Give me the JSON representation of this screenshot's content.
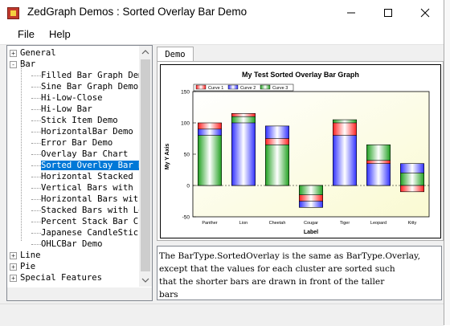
{
  "window": {
    "title": "ZedGraph Demos : Sorted Overlay Bar Demo"
  },
  "menu": {
    "file": "File",
    "help": "Help"
  },
  "tree": {
    "items": [
      {
        "label": "General",
        "expander": "+"
      },
      {
        "label": "Bar",
        "expander": "-"
      },
      {
        "label": "Filled Bar Graph Dem"
      },
      {
        "label": "Sine Bar Graph Demo"
      },
      {
        "label": "Hi-Low-Close"
      },
      {
        "label": "Hi-Low Bar"
      },
      {
        "label": "Stick Item Demo"
      },
      {
        "label": "HorizontalBar Demo"
      },
      {
        "label": "Error Bar Demo"
      },
      {
        "label": "Overlay Bar Chart"
      },
      {
        "label": "Sorted Overlay Bar D"
      },
      {
        "label": "Horizontal Stacked B"
      },
      {
        "label": "Vertical Bars with L"
      },
      {
        "label": "Horizontal Bars with"
      },
      {
        "label": "Stacked Bars with Le"
      },
      {
        "label": "Percent Stack Bar Ch"
      },
      {
        "label": "Japanese CandleStick"
      },
      {
        "label": "OHLCBar Demo"
      },
      {
        "label": "Line",
        "expander": "+"
      },
      {
        "label": "Pie",
        "expander": "+"
      },
      {
        "label": "Special Features",
        "expander": "+"
      }
    ]
  },
  "tabs": {
    "demo": "Demo"
  },
  "chart_data": {
    "type": "bar",
    "title": "My Test Sorted Overlay Bar Graph",
    "xlabel": "Label",
    "ylabel": "My Y Axis",
    "categories": [
      "Panther",
      "Lion",
      "Cheetah",
      "Cougar",
      "Tiger",
      "Leopard",
      "Kitty"
    ],
    "series": [
      {
        "name": "Curve 1",
        "color": "#ff2020",
        "values": [
          100,
          115,
          75,
          -25,
          100,
          40,
          -10
        ]
      },
      {
        "name": "Curve 2",
        "color": "#3030ff",
        "values": [
          90,
          100,
          95,
          -35,
          80,
          35,
          35
        ]
      },
      {
        "name": "Curve 3",
        "color": "#20a020",
        "values": [
          80,
          110,
          65,
          -15,
          105,
          65,
          20
        ]
      }
    ],
    "ylim": [
      -50,
      150
    ],
    "yticks": [
      "150",
      "100",
      "50",
      "0",
      "-50"
    ],
    "legend": "top-left",
    "plot_fill": "light-yellow gradient"
  },
  "description": "The BarType.SortedOverlay is the same as BarType.Overlay,\nexcept that the values for each cluster are sorted such\nthat the shorter bars are drawn in front of the taller\nbars"
}
